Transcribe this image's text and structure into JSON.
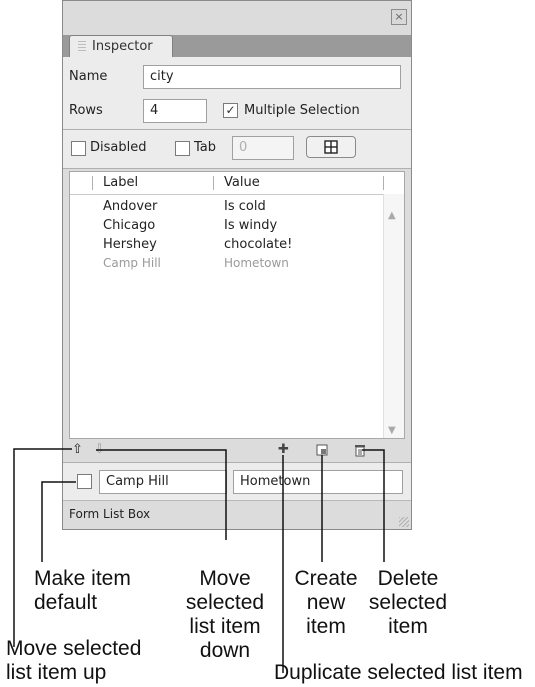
{
  "panel": {
    "tab_title": "Inspector",
    "close_glyph": "×",
    "name_label": "Name",
    "name_value": "city",
    "rows_label": "Rows",
    "rows_value": "4",
    "multiple_selection_label": "Multiple Selection",
    "multiple_selection_checked": true,
    "disabled_label": "Disabled",
    "tab_label": "Tab",
    "tab_index_value": "0",
    "list_columns": [
      "Label",
      "Value"
    ],
    "list_rows": [
      {
        "label": "Andover",
        "value": "Is cold"
      },
      {
        "label": "Chicago",
        "value": "Is windy"
      },
      {
        "label": "Hershey",
        "value": "chocolate!"
      },
      {
        "label": "Camp Hill",
        "value": "Hometown"
      }
    ],
    "edit_label_value": "Camp Hill",
    "edit_value_value": "Hometown",
    "status_text": "Form List Box"
  },
  "callouts": {
    "make_default": "Make item\ndefault",
    "move_down": "Move\nselected\nlist item\ndown",
    "create_new": "Create\nnew\nitem",
    "delete_selected": "Delete\nselected\nitem",
    "move_up": "Move selected\nlist item up",
    "duplicate": "Duplicate selected list item"
  }
}
